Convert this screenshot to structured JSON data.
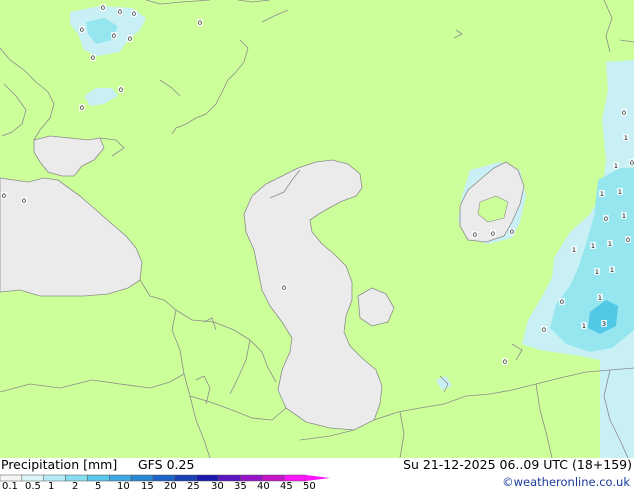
{
  "footer": {
    "title": "Precipitation [mm]",
    "model": "GFS 0.25",
    "valid_time": "Su 21-12-2025 06..09 UTC (18+159)",
    "credit": "©weatheronline.co.uk"
  },
  "legend": {
    "labels": [
      "0.1",
      "0.5",
      "1",
      "2",
      "5",
      "10",
      "15",
      "20",
      "25",
      "30",
      "35",
      "40",
      "45",
      "50"
    ],
    "colors": [
      "#f5f5f5",
      "#dcf5fa",
      "#b4ebf5",
      "#87dcf0",
      "#5ac8eb",
      "#3caae1",
      "#2b87d4",
      "#1e64c8",
      "#1a40b5",
      "#1a1ab0",
      "#5a14c0",
      "#9614c8",
      "#c814c8",
      "#ff14ff"
    ]
  },
  "map": {
    "land_color": "#ccff99",
    "water_color": "#ebebeb",
    "border_color": "#8c8c8c",
    "precip_light": "#c8f0f5",
    "precip_medium": "#96e6f0",
    "precip_heavy": "#50c8e6",
    "value_markers": [
      "0",
      "0",
      "0",
      "0",
      "0",
      "0",
      "0",
      "0",
      "0",
      "0",
      "0",
      "0",
      "0",
      "0",
      "0",
      "0",
      "0",
      "0",
      "1",
      "1",
      "0",
      "1",
      "1",
      "1",
      "0",
      "0",
      "1",
      "1",
      "1",
      "1",
      "1",
      "3",
      "1",
      "1",
      "0",
      "0"
    ]
  }
}
